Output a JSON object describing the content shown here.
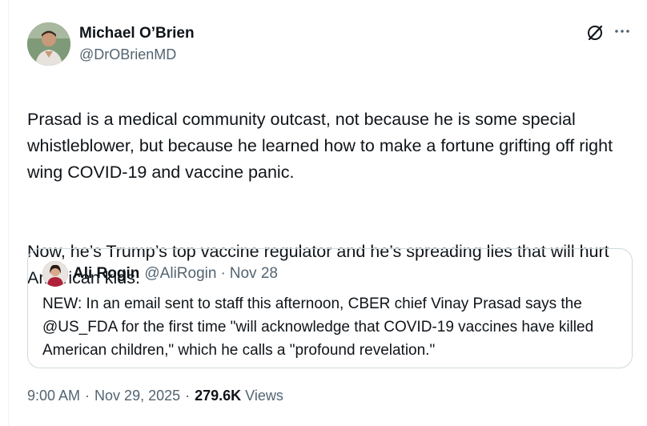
{
  "author": {
    "display_name": "Michael O’Brien",
    "handle": "@DrOBrienMD"
  },
  "icons": {
    "grok": "grok-icon",
    "more": "more-icon"
  },
  "tweet": {
    "paragraphs": [
      "Prasad is a medical community outcast, not because he is some special whistleblower, but because he learned how to make a fortune grifting off right wing COVID-19 and vaccine panic.",
      "Now, he’s Trump’s top vaccine regulator and he’s spreading lies that will hurt American kids."
    ]
  },
  "quote": {
    "display_name": "Ali Rogin",
    "handle": "@AliRogin",
    "separator": "·",
    "date": "Nov 28",
    "text": "NEW: In an email sent to staff this afternoon, CBER chief Vinay Prasad says the @US_FDA for the first time \"will acknowledge that COVID-19 vaccines have killed American children,\" which he calls a \"profound revelation.\""
  },
  "meta": {
    "time": "9:00 AM",
    "separator": "·",
    "date": "Nov 29, 2025",
    "views_count": "279.6K",
    "views_label": "Views"
  },
  "colors": {
    "text_primary": "#0f1419",
    "text_secondary": "#536471",
    "border": "#cfd9de"
  }
}
